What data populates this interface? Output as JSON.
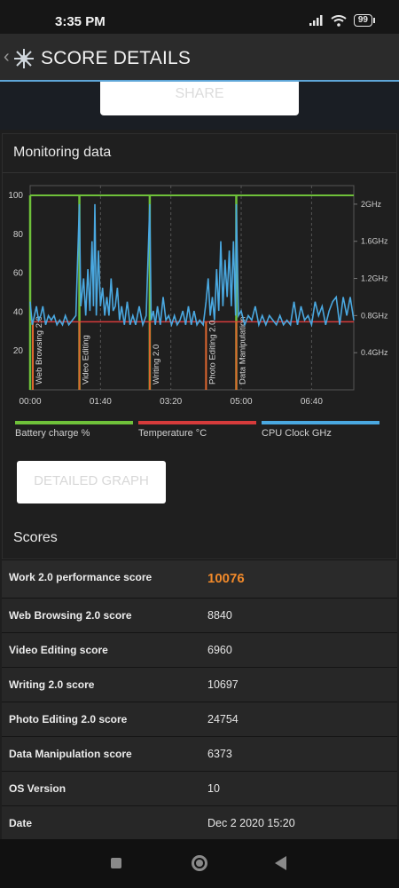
{
  "status": {
    "time": "3:35 PM",
    "battery": "99"
  },
  "app_bar": {
    "title": "SCORE DETAILS",
    "back": "‹"
  },
  "share": {
    "label": "SHARE"
  },
  "monitoring": {
    "title": "Monitoring data",
    "detailed_button": "DETAILED GRAPH"
  },
  "chart_data": {
    "type": "line",
    "x_ticks": [
      "00:00",
      "01:40",
      "03:20",
      "05:00",
      "06:40"
    ],
    "x_tick_seconds": [
      0,
      100,
      200,
      300,
      400
    ],
    "x_range_seconds": [
      0,
      460
    ],
    "y_left_ticks": [
      20,
      40,
      60,
      80,
      100
    ],
    "y_left_range": [
      0,
      105
    ],
    "y_right_ticks": [
      "0.4GHz",
      "0.8GHz",
      "1.2GHz",
      "1.6GHz",
      "2GHz"
    ],
    "y_right_values": [
      0.4,
      0.8,
      1.2,
      1.6,
      2.0
    ],
    "y_right_range": [
      0,
      2.2
    ],
    "legend": [
      {
        "name": "Battery charge %",
        "color": "#6fc13a"
      },
      {
        "name": "Temperature °C",
        "color": "#d63b3b"
      },
      {
        "name": "CPU Clock GHz",
        "color": "#4aa8e0"
      }
    ],
    "segments": [
      {
        "label": "Web Browsing 2.0",
        "start_s": 0
      },
      {
        "label": "Video Editing",
        "start_s": 70
      },
      {
        "label": "Writing 2.0",
        "start_s": 170
      },
      {
        "label": "Photo Editing 2.0",
        "start_s": 250
      },
      {
        "label": "Data Manipulation",
        "start_s": 293
      }
    ],
    "battery_series": [
      [
        0,
        0
      ],
      [
        2,
        100
      ],
      [
        460,
        100
      ]
    ],
    "battery_spikes_s": [
      0,
      70,
      170,
      293
    ],
    "temperature_series": [
      [
        0,
        35
      ],
      [
        460,
        35
      ]
    ],
    "cpu_series": [
      [
        0,
        0.95
      ],
      [
        3,
        0.7
      ],
      [
        6,
        0.8
      ],
      [
        9,
        0.9
      ],
      [
        12,
        0.75
      ],
      [
        15,
        0.8
      ],
      [
        18,
        0.9
      ],
      [
        22,
        0.7
      ],
      [
        26,
        0.8
      ],
      [
        30,
        0.75
      ],
      [
        34,
        0.8
      ],
      [
        38,
        0.7
      ],
      [
        42,
        0.75
      ],
      [
        46,
        0.7
      ],
      [
        50,
        0.8
      ],
      [
        55,
        0.7
      ],
      [
        60,
        0.75
      ],
      [
        65,
        0.8
      ],
      [
        70,
        2.0
      ],
      [
        72,
        0.9
      ],
      [
        76,
        1.2
      ],
      [
        79,
        0.8
      ],
      [
        82,
        1.3
      ],
      [
        85,
        0.85
      ],
      [
        88,
        1.6
      ],
      [
        90,
        0.9
      ],
      [
        92,
        2.0
      ],
      [
        94,
        0.8
      ],
      [
        97,
        1.5
      ],
      [
        100,
        0.9
      ],
      [
        103,
        1.1
      ],
      [
        106,
        0.8
      ],
      [
        109,
        1.0
      ],
      [
        112,
        0.8
      ],
      [
        115,
        1.2
      ],
      [
        118,
        0.85
      ],
      [
        121,
        0.9
      ],
      [
        124,
        1.1
      ],
      [
        127,
        0.75
      ],
      [
        130,
        0.9
      ],
      [
        134,
        0.7
      ],
      [
        138,
        0.95
      ],
      [
        142,
        0.7
      ],
      [
        146,
        0.8
      ],
      [
        150,
        0.7
      ],
      [
        155,
        0.9
      ],
      [
        160,
        0.7
      ],
      [
        165,
        0.8
      ],
      [
        170,
        2.0
      ],
      [
        172,
        0.75
      ],
      [
        175,
        0.85
      ],
      [
        178,
        0.7
      ],
      [
        181,
        0.9
      ],
      [
        185,
        0.7
      ],
      [
        189,
        1.0
      ],
      [
        193,
        0.75
      ],
      [
        197,
        0.8
      ],
      [
        201,
        0.7
      ],
      [
        205,
        0.8
      ],
      [
        209,
        0.7
      ],
      [
        213,
        0.75
      ],
      [
        217,
        0.85
      ],
      [
        221,
        0.7
      ],
      [
        225,
        0.9
      ],
      [
        229,
        0.7
      ],
      [
        233,
        0.85
      ],
      [
        237,
        0.7
      ],
      [
        241,
        0.75
      ],
      [
        246,
        0.7
      ],
      [
        250,
        0.95
      ],
      [
        253,
        1.2
      ],
      [
        256,
        0.8
      ],
      [
        259,
        1.0
      ],
      [
        262,
        0.75
      ],
      [
        265,
        1.3
      ],
      [
        268,
        0.85
      ],
      [
        271,
        1.6
      ],
      [
        274,
        0.9
      ],
      [
        277,
        1.4
      ],
      [
        280,
        1.0
      ],
      [
        283,
        1.5
      ],
      [
        286,
        0.9
      ],
      [
        289,
        1.6
      ],
      [
        292,
        0.8
      ],
      [
        293,
        2.0
      ],
      [
        296,
        0.8
      ],
      [
        300,
        0.85
      ],
      [
        305,
        0.7
      ],
      [
        310,
        0.8
      ],
      [
        315,
        0.75
      ],
      [
        320,
        0.9
      ],
      [
        325,
        0.7
      ],
      [
        330,
        0.8
      ],
      [
        335,
        0.7
      ],
      [
        340,
        0.8
      ],
      [
        345,
        0.75
      ],
      [
        350,
        0.7
      ],
      [
        355,
        0.8
      ],
      [
        360,
        0.7
      ],
      [
        365,
        0.75
      ],
      [
        370,
        0.7
      ],
      [
        375,
        0.95
      ],
      [
        380,
        0.7
      ],
      [
        385,
        0.9
      ],
      [
        390,
        0.75
      ],
      [
        395,
        0.8
      ],
      [
        400,
        0.7
      ],
      [
        405,
        0.95
      ],
      [
        410,
        0.8
      ],
      [
        415,
        0.9
      ],
      [
        420,
        0.7
      ],
      [
        425,
        0.85
      ],
      [
        430,
        0.95
      ],
      [
        435,
        1.0
      ],
      [
        440,
        0.7
      ],
      [
        445,
        1.0
      ],
      [
        450,
        0.8
      ],
      [
        455,
        1.0
      ],
      [
        460,
        0.75
      ]
    ]
  },
  "scores": {
    "title": "Scores",
    "rows": [
      {
        "label": "Work 2.0 performance score",
        "value": "10076"
      },
      {
        "label": "Web Browsing 2.0 score",
        "value": "8840"
      },
      {
        "label": "Video Editing score",
        "value": "6960"
      },
      {
        "label": "Writing 2.0 score",
        "value": "10697"
      },
      {
        "label": "Photo Editing 2.0 score",
        "value": "24754"
      },
      {
        "label": "Data Manipulation score",
        "value": "6373"
      },
      {
        "label": "OS Version",
        "value": "10"
      },
      {
        "label": "Date",
        "value": "Dec 2 2020 15:20"
      }
    ]
  }
}
